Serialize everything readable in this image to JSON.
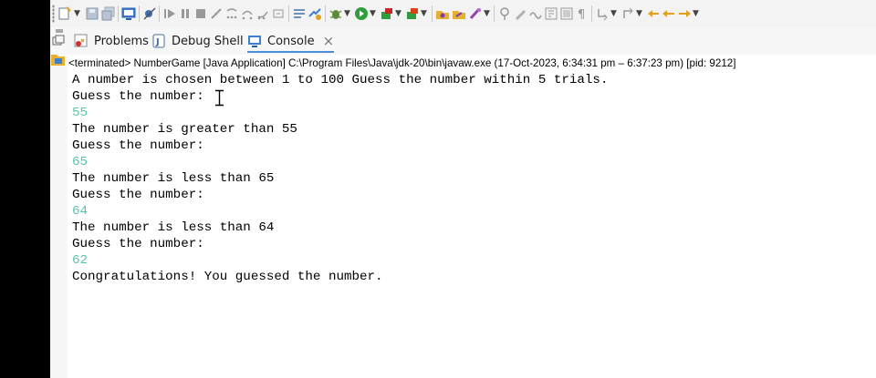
{
  "toolbar": {
    "icons": [
      "new-icon",
      "save-icon",
      "save-all-icon",
      "console-icon",
      "skip-breakpoints-icon",
      "resume-icon",
      "suspend-icon",
      "terminate-icon",
      "disconnect-icon",
      "step-into-icon",
      "step-over-icon",
      "step-return-icon",
      "drop-to-frame-icon",
      "use-step-filters-icon",
      "debug-icon",
      "run-icon",
      "run-external-icon",
      "coverage-icon",
      "open-type-icon",
      "open-task-icon",
      "search-icon",
      "pin-icon",
      "highlight-icon",
      "toggle-breadcrumb-icon",
      "show-whitespace-icon",
      "block-selection-icon",
      "next-annotation-icon",
      "prev-annotation-icon",
      "last-edit-icon",
      "back-icon",
      "forward-icon"
    ]
  },
  "tabs": [
    {
      "label": "Problems",
      "icon": "problems-icon",
      "active": false
    },
    {
      "label": "Debug Shell",
      "icon": "debug-shell-icon",
      "active": false
    },
    {
      "label": "Console",
      "icon": "console-icon",
      "active": true,
      "close": "×"
    }
  ],
  "console": {
    "header": "<terminated> NumberGame [Java Application] C:\\Program Files\\Java\\jdk-20\\bin\\javaw.exe  (17-Oct-2023, 6:34:31 pm – 6:37:23 pm) [pid: 9212]",
    "lines": [
      {
        "text": "A number is chosen between 1 to 100 Guess the number within 5 trials.",
        "kind": "output"
      },
      {
        "text": "Guess the number:",
        "kind": "output"
      },
      {
        "text": "55",
        "kind": "input"
      },
      {
        "text": "The number is greater than 55",
        "kind": "output"
      },
      {
        "text": "Guess the number:",
        "kind": "output"
      },
      {
        "text": "65",
        "kind": "input"
      },
      {
        "text": "The number is less than 65",
        "kind": "output"
      },
      {
        "text": "Guess the number:",
        "kind": "output"
      },
      {
        "text": "64",
        "kind": "input"
      },
      {
        "text": "The number is less than 64",
        "kind": "output"
      },
      {
        "text": "Guess the number:",
        "kind": "output"
      },
      {
        "text": "62",
        "kind": "input"
      },
      {
        "text": "Congratulations! You guessed the number.",
        "kind": "output"
      }
    ],
    "colors": {
      "output": "#000000",
      "input": "#56c4a9",
      "active_tab_underline": "#4b8fd8"
    }
  }
}
